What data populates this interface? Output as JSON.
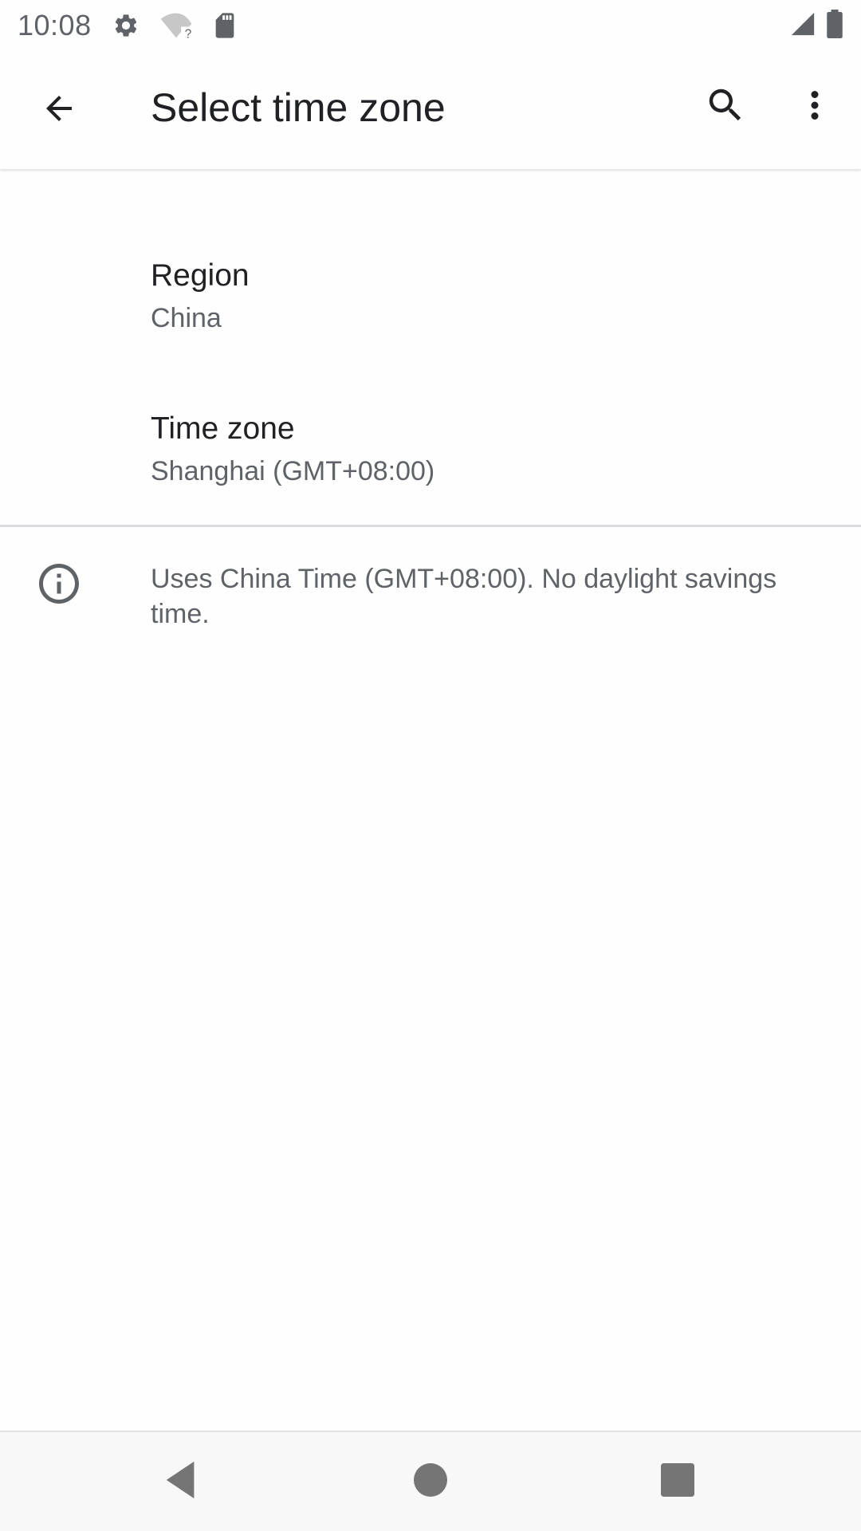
{
  "status_bar": {
    "time": "10:08",
    "icons_left": [
      "gear-icon",
      "wifi-unknown-icon",
      "sd-card-icon"
    ],
    "icons_right": [
      "cell-signal-icon",
      "battery-icon"
    ]
  },
  "app_bar": {
    "title": "Select time zone",
    "back_icon": "arrow-back-icon",
    "search_icon": "search-icon",
    "more_icon": "more-vert-icon"
  },
  "preferences": [
    {
      "title": "Region",
      "summary": "China"
    },
    {
      "title": "Time zone",
      "summary": "Shanghai (GMT+08:00)"
    }
  ],
  "info": {
    "icon": "info-icon",
    "text": "Uses China Time (GMT+08:00). No daylight savings time."
  },
  "nav_bar": {
    "buttons": [
      "back-triangle-icon",
      "home-circle-icon",
      "recents-square-icon"
    ]
  },
  "colors": {
    "background": "#fefefe",
    "primary_text": "#202124",
    "secondary_text": "#5f6368",
    "divider": "#dadce0",
    "nav_bar": "#f8f8f8"
  }
}
